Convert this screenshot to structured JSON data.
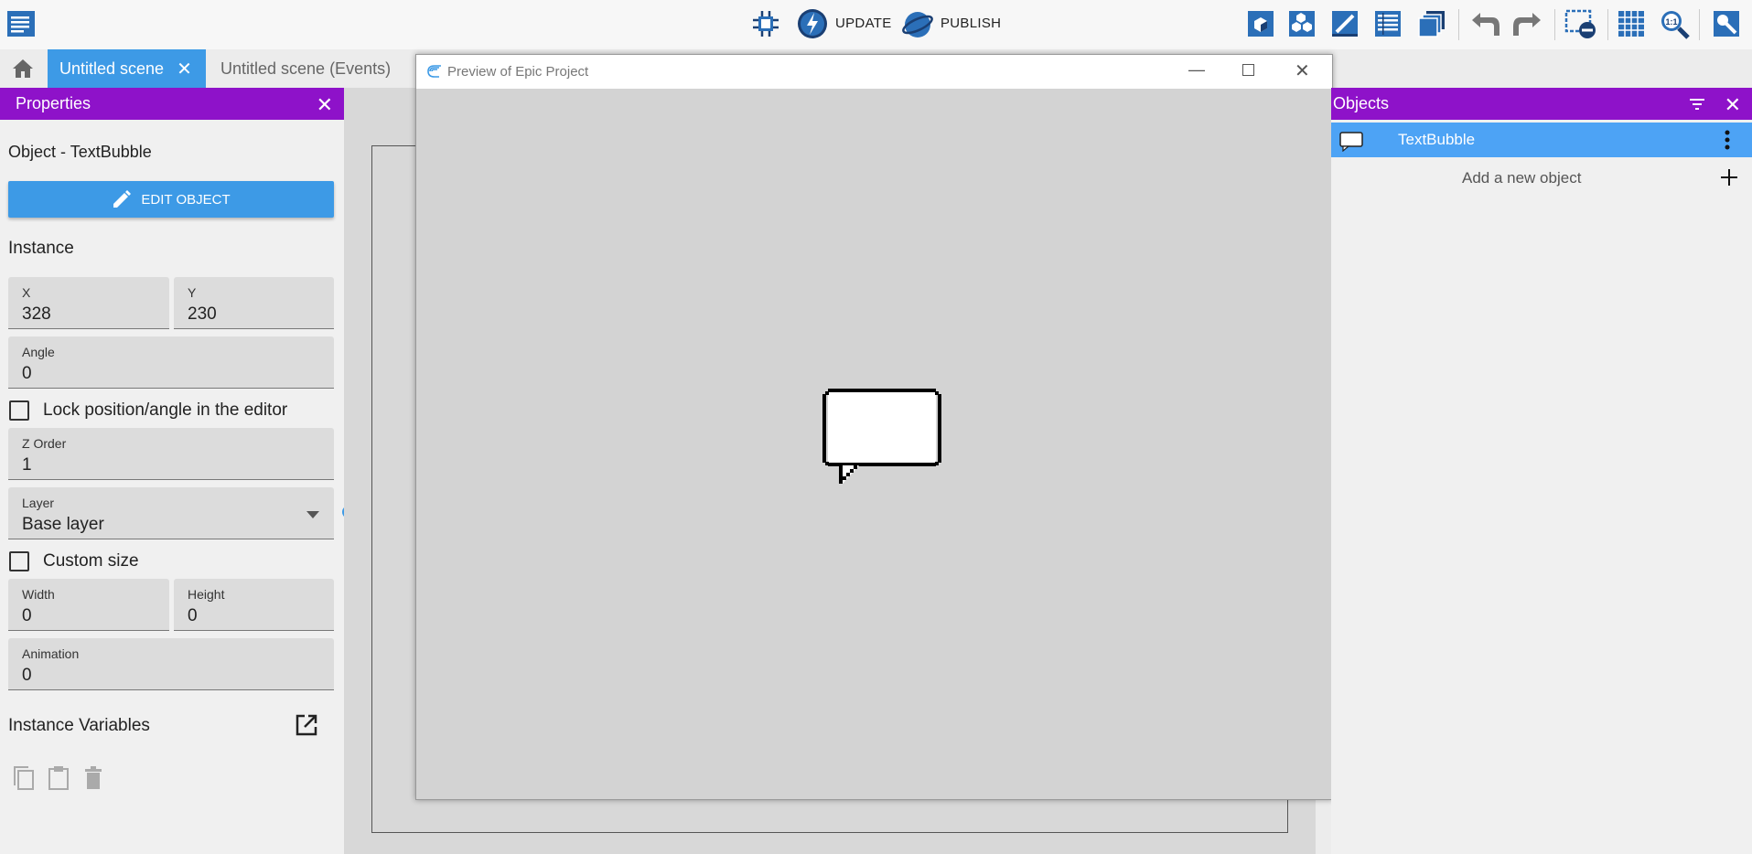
{
  "toolbar": {
    "update_label": "UPDATE",
    "publish_label": "PUBLISH"
  },
  "tabs": [
    {
      "label": "Untitled scene",
      "active": true
    },
    {
      "label": "Untitled scene (Events)",
      "active": false
    }
  ],
  "properties": {
    "header": "Properties",
    "object_title": "Object - TextBubble",
    "edit_object_label": "EDIT OBJECT",
    "instance_section": "Instance",
    "x": {
      "label": "X",
      "value": "328"
    },
    "y": {
      "label": "Y",
      "value": "230"
    },
    "angle": {
      "label": "Angle",
      "value": "0"
    },
    "lock_label": "Lock position/angle in the editor",
    "z_order": {
      "label": "Z Order",
      "value": "1"
    },
    "layer": {
      "label": "Layer",
      "value": "Base layer"
    },
    "custom_size_label": "Custom size",
    "width": {
      "label": "Width",
      "value": "0"
    },
    "height": {
      "label": "Height",
      "value": "0"
    },
    "animation": {
      "label": "Animation",
      "value": "0"
    },
    "instance_variables_label": "Instance Variables"
  },
  "preview": {
    "title": "Preview of Epic Project"
  },
  "objects": {
    "header": "Objects",
    "items": [
      {
        "name": "TextBubble",
        "selected": true
      }
    ],
    "add_label": "Add a new object"
  },
  "colors": {
    "accent": "#3d9ae6",
    "panel_header": "#8e12c9",
    "selected_row": "#4da3f5"
  }
}
